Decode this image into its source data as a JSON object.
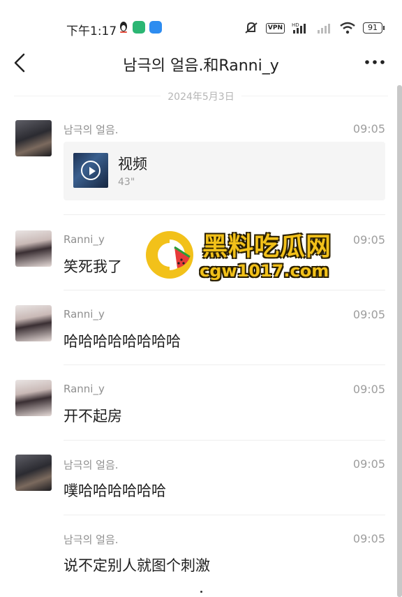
{
  "status_bar": {
    "time": "下午1:17",
    "vpn": "VPN",
    "hd": "HD",
    "battery": "91"
  },
  "header": {
    "title": "남극의 얼음.和Ranni_y"
  },
  "date": "2024年5月3日",
  "messages": [
    {
      "sender": "남극의 얼음.",
      "time": "09:05",
      "video_label": "视频",
      "video_duration": "43\""
    },
    {
      "sender": "Ranni_y",
      "time": "09:05",
      "text": "笑死我了"
    },
    {
      "sender": "Ranni_y",
      "time": "09:05",
      "text": "哈哈哈哈哈哈哈哈"
    },
    {
      "sender": "Ranni_y",
      "time": "09:05",
      "text": "开不起房"
    },
    {
      "sender": "남극의 얼음.",
      "time": "09:05",
      "text": "噗哈哈哈哈哈哈"
    },
    {
      "sender": "남극의 얼음.",
      "time": "09:05",
      "text": "说不定别人就图个刺激"
    }
  ],
  "watermark": {
    "title": "黑料吃瓜网",
    "url": "cgw1017.com"
  },
  "colors": {
    "accent_yellow": "#f2c11a",
    "app_green": "#2bb673",
    "app_blue": "#2d8cf0"
  }
}
